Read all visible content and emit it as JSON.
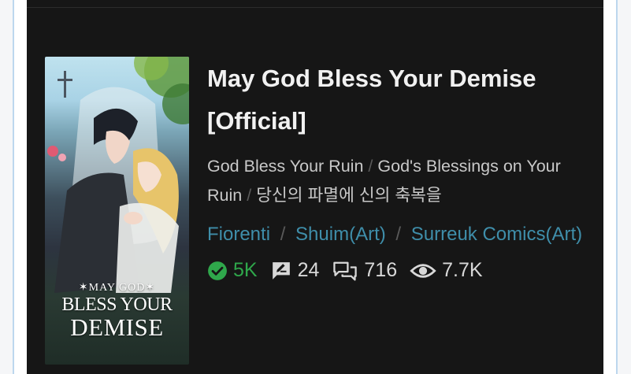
{
  "manga": {
    "title": "May God Bless Your Demise [Official]",
    "alt_titles": [
      "God Bless Your Ruin",
      "God's Blessings on Your Ruin",
      "당신의 파멸에 신의 축복을"
    ],
    "authors": [
      "Fiorenti",
      "Shuim(Art)",
      "Surreuk Comics(Art)"
    ],
    "cover": {
      "line1": "✶MAY GOD✶",
      "line2": "BLESS YOUR",
      "line3": "DEMISE"
    },
    "stats": {
      "follows": "5K",
      "comments": "24",
      "threads": "716",
      "views": "7.7K"
    }
  },
  "colors": {
    "card_bg": "#161616",
    "link": "#3f8eaa",
    "follow_green": "#2fa74b",
    "text": "#f1f1f1"
  },
  "icons": [
    "check-circle-icon",
    "comment-icon",
    "threads-icon",
    "eye-icon"
  ]
}
